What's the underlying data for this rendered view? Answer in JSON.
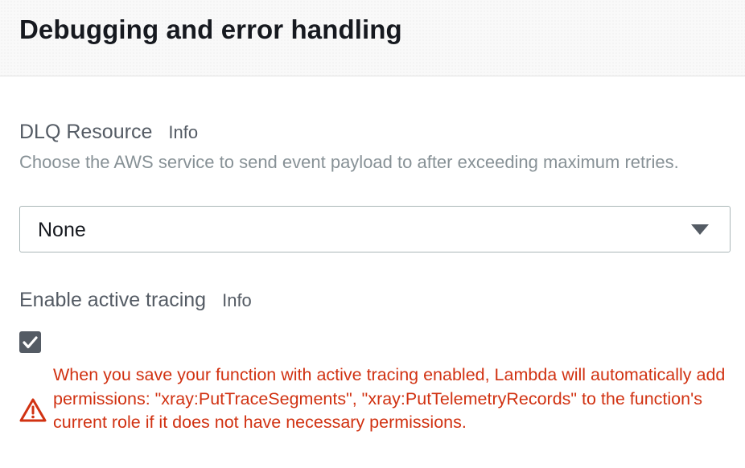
{
  "section": {
    "title": "Debugging and error handling"
  },
  "dlq": {
    "label": "DLQ Resource",
    "info_link": "Info",
    "description": "Choose the AWS service to send event payload to after exceeding maximum retries.",
    "selected_value": "None"
  },
  "tracing": {
    "label": "Enable active tracing",
    "info_link": "Info",
    "checked": true,
    "warning": "When you save your function with active tracing enabled, Lambda will automatically add permissions: \"xray:PutTraceSegments\", \"xray:PutTelemetryRecords\" to the function's current role if it does not have necessary permissions."
  },
  "colors": {
    "warning": "#d13212",
    "label": "#545b64",
    "description": "#879196",
    "checkbox": "#545b64"
  },
  "icons": {
    "select_arrow": "caret-down-icon",
    "checkbox_mark": "checkmark-icon",
    "warning": "warning-triangle-icon"
  }
}
